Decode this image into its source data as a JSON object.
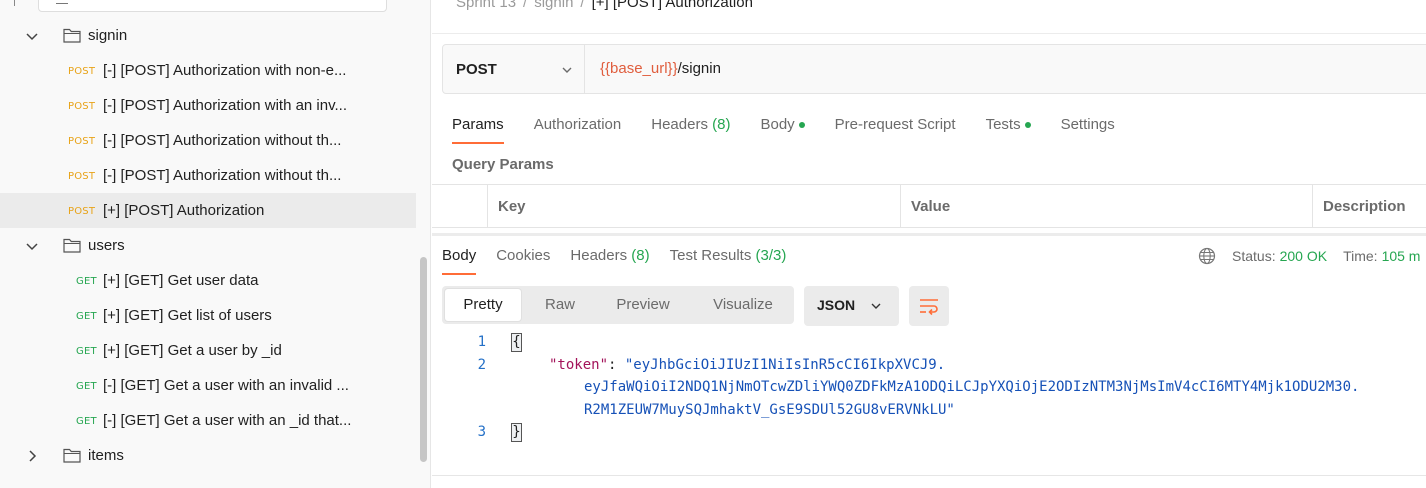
{
  "sidebar": {
    "rows": [
      {
        "type": "folder",
        "expanded": true,
        "label": "signin"
      },
      {
        "type": "request",
        "method": "POST",
        "label": "[-] [POST] Authorization with non-e..."
      },
      {
        "type": "request",
        "method": "POST",
        "label": "[-] [POST] Authorization with an inv..."
      },
      {
        "type": "request",
        "method": "POST",
        "label": "[-] [POST] Authorization without th..."
      },
      {
        "type": "request",
        "method": "POST",
        "label": "[-] [POST] Authorization without th..."
      },
      {
        "type": "request",
        "method": "POST",
        "label": "[+] [POST] Authorization",
        "selected": true
      },
      {
        "type": "folder",
        "expanded": true,
        "label": "users"
      },
      {
        "type": "request",
        "method": "GET",
        "label": "[+] [GET] Get user data"
      },
      {
        "type": "request",
        "method": "GET",
        "label": "[+] [GET] Get list of users"
      },
      {
        "type": "request",
        "method": "GET",
        "label": "[+] [GET] Get a user by _id"
      },
      {
        "type": "request",
        "method": "GET",
        "label": "[-] [GET] Get a user with an invalid ..."
      },
      {
        "type": "request",
        "method": "GET",
        "label": "[-] [GET] Get a user with an _id that..."
      },
      {
        "type": "folder",
        "expanded": false,
        "label": "items"
      }
    ]
  },
  "breadcrumb": {
    "items": [
      "Sprint 13",
      "signin"
    ],
    "current": "[+] [POST] Authorization"
  },
  "request": {
    "method": "POST",
    "url_variable": "{{base_url}}",
    "url_path": "/signin",
    "tabs": [
      {
        "label": "Params",
        "active": true
      },
      {
        "label": "Authorization"
      },
      {
        "label": "Headers",
        "count": "(8)"
      },
      {
        "label": "Body",
        "dot": true
      },
      {
        "label": "Pre-request Script"
      },
      {
        "label": "Tests",
        "dot": true
      },
      {
        "label": "Settings"
      }
    ],
    "query_params_title": "Query Params",
    "table_headers": [
      "Key",
      "Value",
      "Description"
    ]
  },
  "response": {
    "tabs": [
      {
        "label": "Body",
        "active": true
      },
      {
        "label": "Cookies"
      },
      {
        "label": "Headers",
        "count": "(8)"
      },
      {
        "label": "Test Results",
        "count": "(3/3)"
      }
    ],
    "status_label": "Status:",
    "status_value": "200 OK",
    "time_label": "Time:",
    "time_value": "105 m",
    "view_options": [
      "Pretty",
      "Raw",
      "Preview",
      "Visualize"
    ],
    "active_view": "Pretty",
    "format": "JSON",
    "code": {
      "line_numbers": [
        "1",
        "2",
        "3"
      ],
      "open_brace": "{",
      "close_brace": "}",
      "key": "\"token\"",
      "colon": ": ",
      "value_line1": "\"eyJhbGciOiJIUzI1NiIsInR5cCI6IkpXVCJ9.",
      "value_line2": "eyJfaWQiOiI2NDQ1NjNmOTcwZDliYWQ0ZDFkMzA1ODQiLCJpYXQiOjE2ODIzNTM3NjMsImV4cCI6MTY4Mjk1ODU2M30.",
      "value_line3": "R2M1ZEUW7MuySQJmhaktV_GsE9SDUl52GU8vERVNkLU\""
    }
  },
  "colors": {
    "accent": "#ff6c37",
    "post": "#e8a318",
    "get": "#26a651",
    "green": "#26a651",
    "url_var": "#e05e3e"
  }
}
